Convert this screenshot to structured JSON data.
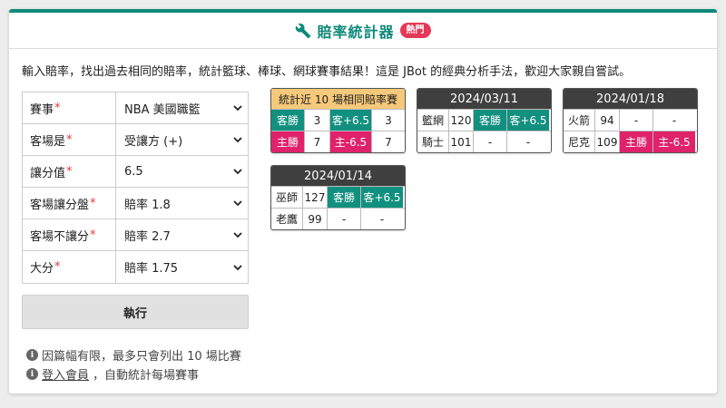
{
  "header": {
    "title": "賠率統計器",
    "badge": "熱門"
  },
  "description": "輸入賠率，找出過去相同的賠率，統計籃球、棒球、網球賽事結果！這是 JBot 的經典分析手法，歡迎大家親自嘗試。",
  "form": {
    "rows": [
      {
        "label": "賽事",
        "value": "NBA 美國職籃"
      },
      {
        "label": "客場是",
        "value": "受讓方 (+)"
      },
      {
        "label": "讓分值",
        "value": "6.5"
      },
      {
        "label": "客場讓分盤",
        "value": "賠率 1.8"
      },
      {
        "label": "客場不讓分",
        "value": "賠率 2.7"
      },
      {
        "label": "大分",
        "value": "賠率 1.75"
      }
    ],
    "required_mark": "*",
    "run_label": "執行"
  },
  "notes": {
    "note1": "因篇幅有限，最多只會列出 10 場比賽",
    "note2_link": "登入會員",
    "note2_rest": "，自動統計每場賽事"
  },
  "summary": {
    "title": "統計近 10 場相同賠率賽",
    "rows": [
      [
        "客勝",
        "3",
        "客+6.5",
        "3"
      ],
      [
        "主勝",
        "7",
        "主-6.5",
        "7"
      ]
    ]
  },
  "games": [
    {
      "date": "2024/03/11",
      "rows": [
        [
          "籃網",
          "120",
          "客勝",
          "客+6.5"
        ],
        [
          "騎士",
          "101",
          "-",
          "-"
        ]
      ]
    },
    {
      "date": "2024/01/18",
      "rows": [
        [
          "火箭",
          "94",
          "-",
          "-"
        ],
        [
          "尼克",
          "109",
          "主勝",
          "主-6.5"
        ]
      ]
    },
    {
      "date": "2024/01/14",
      "rows": [
        [
          "巫師",
          "127",
          "客勝",
          "客+6.5"
        ],
        [
          "老鷹",
          "99",
          "-",
          "-"
        ]
      ]
    }
  ],
  "colors": {
    "accent": "#0e8a7a",
    "away_win": "#12907f",
    "home_win": "#e0226b",
    "badge": "#e53957"
  }
}
